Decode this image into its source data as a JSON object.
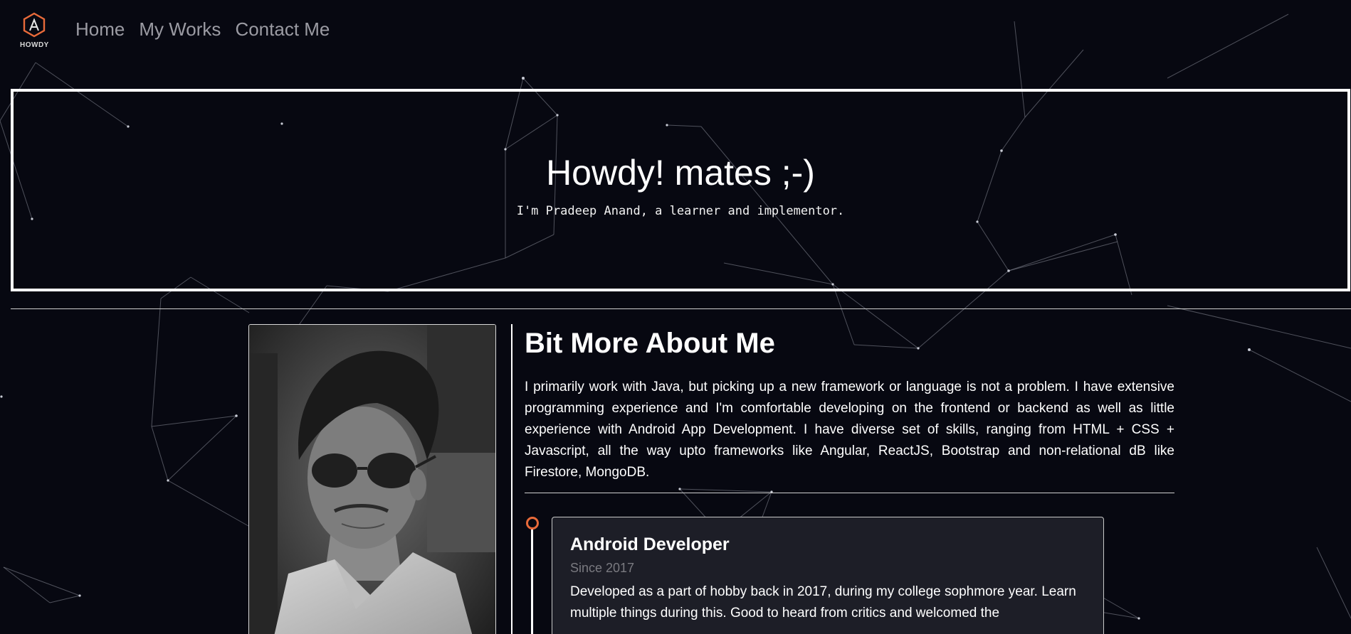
{
  "nav": {
    "logo_text": "HOWDY",
    "links": [
      {
        "label": "Home"
      },
      {
        "label": "My Works"
      },
      {
        "label": "Contact Me"
      }
    ]
  },
  "hero": {
    "title": "Howdy! mates ;-)",
    "subtitle": "I'm Pradeep Anand, a learner and implementor."
  },
  "about": {
    "title": "Bit More About Me",
    "text": "I primarily work with Java, but picking up a new framework or language is not a problem. I have extensive programming experience and I'm comfortable developing on the frontend or backend as well as little experience with Android App Development. I have diverse set of skills, ranging from HTML + CSS + Javascript, all the way upto frameworks like Angular, ReactJS, Bootstrap and non-relational dB like Firestore, MongoDB."
  },
  "timeline": {
    "items": [
      {
        "title": "Android Developer",
        "since": "Since 2017",
        "description": "Developed as a part of hobby back in 2017, during my college sophmore year. Learn multiple things during this. Good to heard from critics and welcomed the"
      }
    ]
  },
  "colors": {
    "background": "#070811",
    "accent": "#e86a3a",
    "card_background": "#1d1e27"
  },
  "icons": {
    "logo": "hexagon-a-logo-icon",
    "timeline_marker": "circle-marker-icon"
  }
}
